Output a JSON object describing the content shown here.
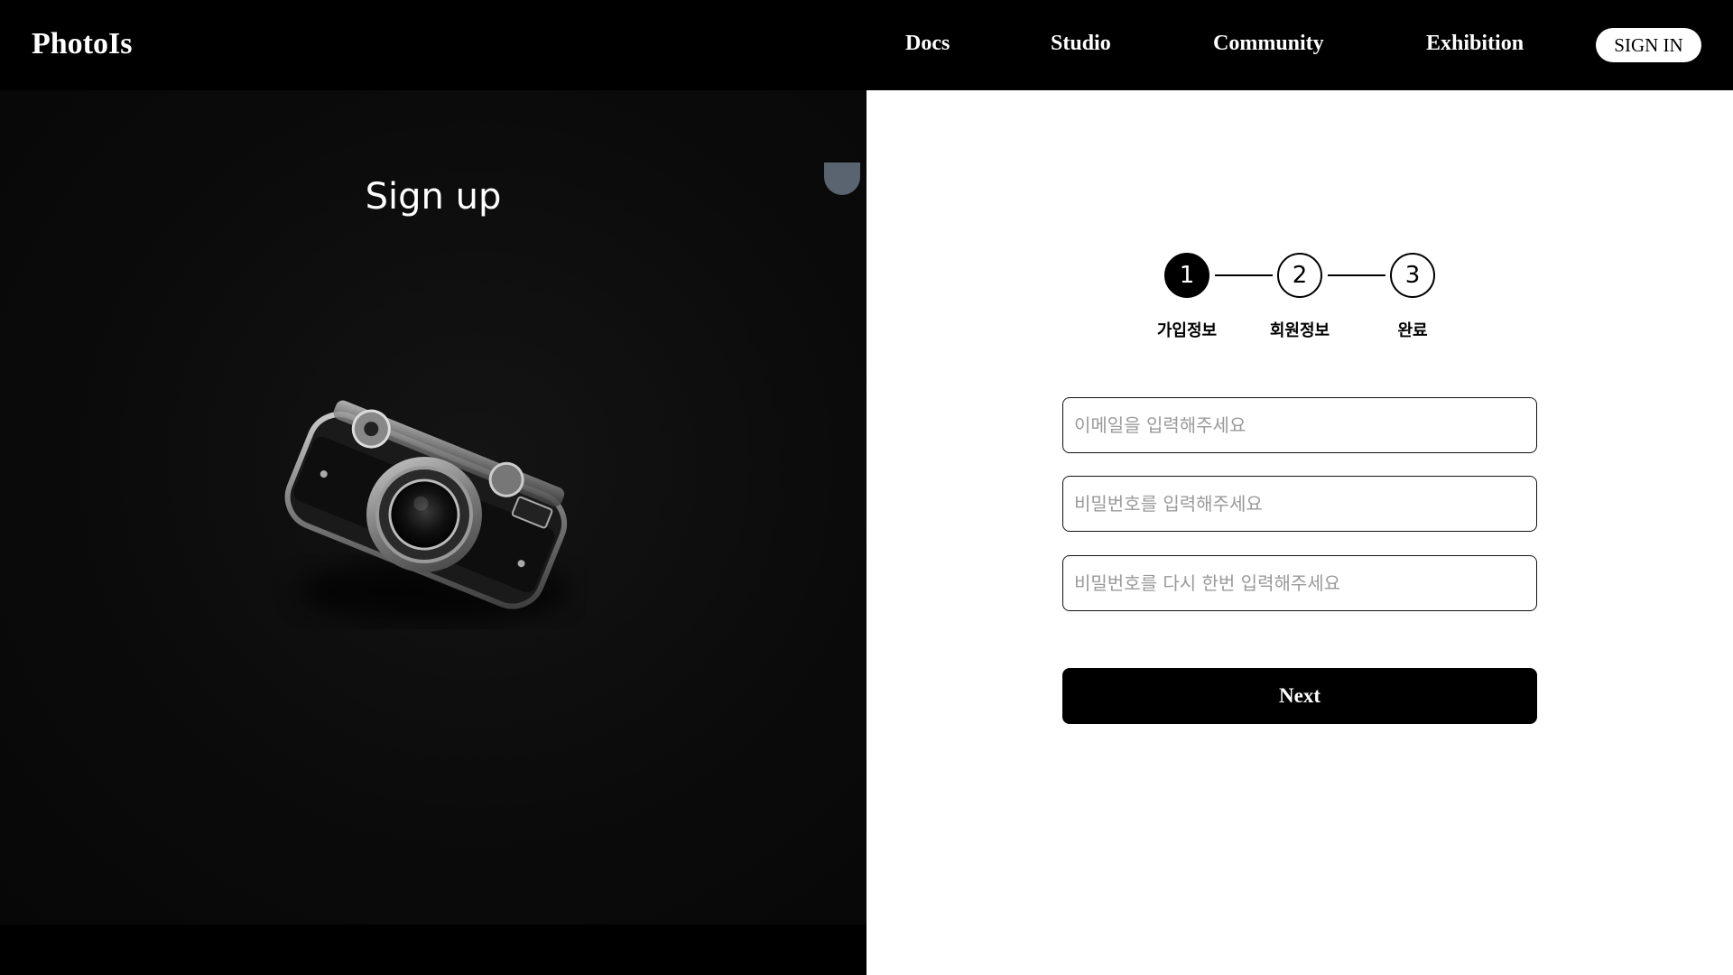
{
  "header": {
    "logo": "PhotoIs",
    "nav": [
      "Docs",
      "Studio",
      "Community",
      "Exhibition"
    ],
    "signin_label": "SIGN IN"
  },
  "hero": {
    "title": "Sign up",
    "image": "camera-photo"
  },
  "stepper": {
    "steps": [
      {
        "number": "1",
        "label": "가입정보"
      },
      {
        "number": "2",
        "label": "회원정보"
      },
      {
        "number": "3",
        "label": "완료"
      }
    ],
    "active_step": 1
  },
  "form": {
    "email_placeholder": "이메일을 입력해주세요",
    "password_placeholder": "비밀번호를 입력해주세요",
    "password_confirm_placeholder": "비밀번호를 다시 한번 입력해주세요",
    "email_value": "",
    "password_value": "",
    "password_confirm_value": "",
    "next_label": "Next"
  },
  "colors": {
    "primary": "#000000",
    "background_right": "#ffffff",
    "placeholder": "#9a9a9a"
  }
}
